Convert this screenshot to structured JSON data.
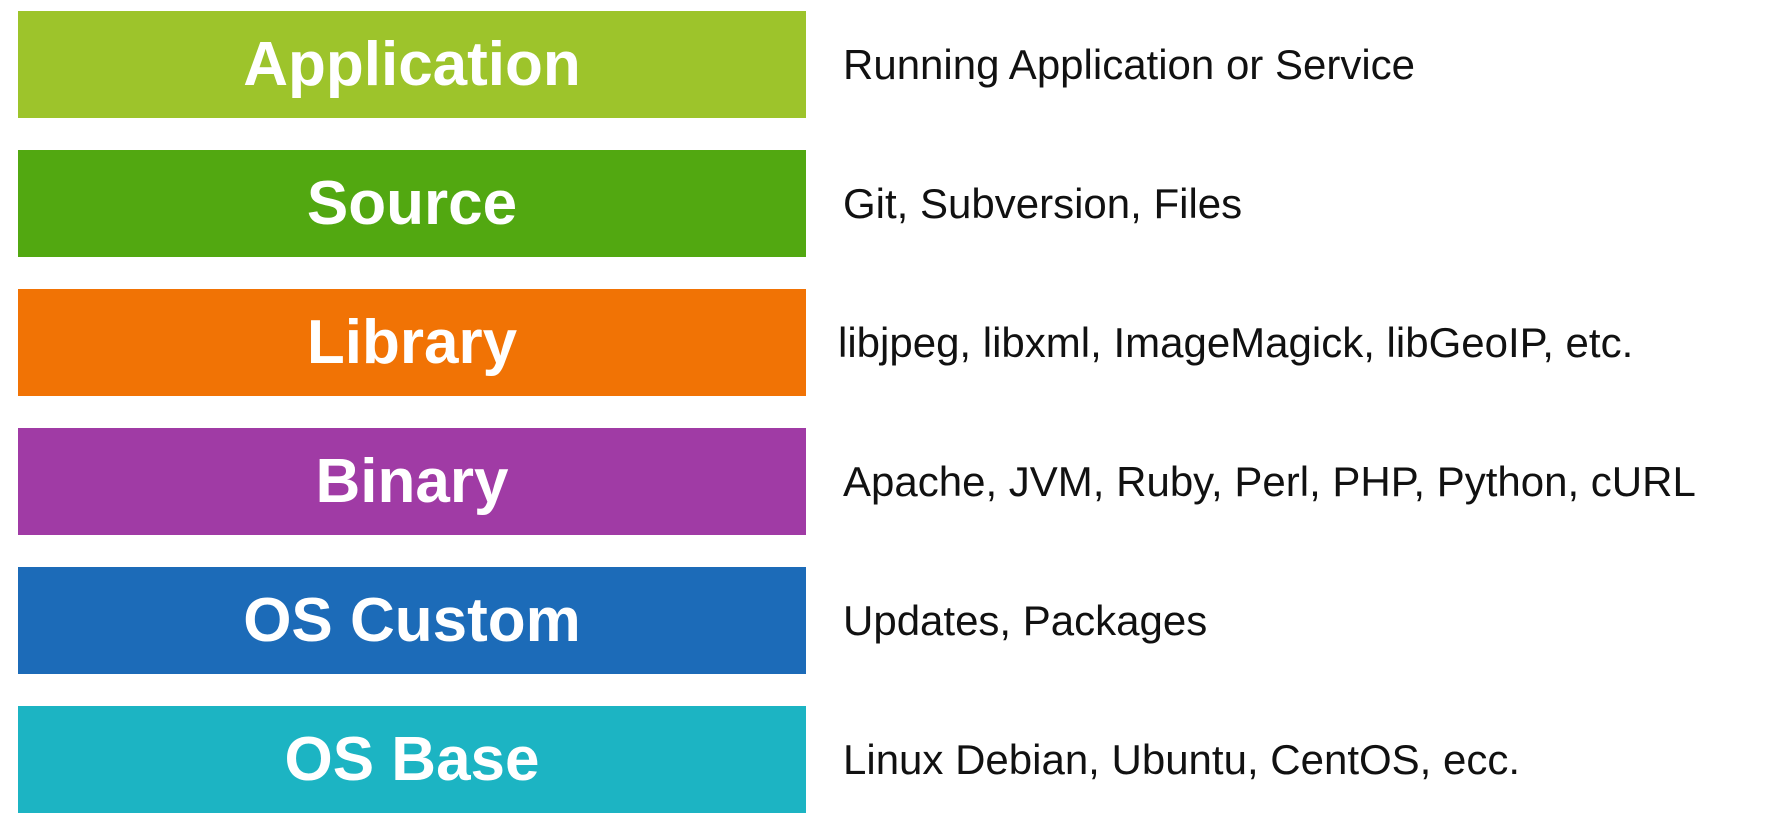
{
  "layers": [
    {
      "name": "Application",
      "description": "Running Application or Service",
      "color": "#9dc42b"
    },
    {
      "name": "Source",
      "description": "Git, Subversion, Files",
      "color": "#52a811"
    },
    {
      "name": "Library",
      "description": "libjpeg, libxml, ImageMagick, libGeoIP, etc.",
      "color": "#f17305"
    },
    {
      "name": "Binary",
      "description": "Apache, JVM, Ruby, Perl, PHP, Python, cURL",
      "color": "#a03ba5"
    },
    {
      "name": "OS Custom",
      "description": "Updates, Packages",
      "color": "#1c6bb8"
    },
    {
      "name": "OS Base",
      "description": "Linux Debian, Ubuntu, CentOS, ecc.",
      "color": "#1cb4c3"
    }
  ]
}
